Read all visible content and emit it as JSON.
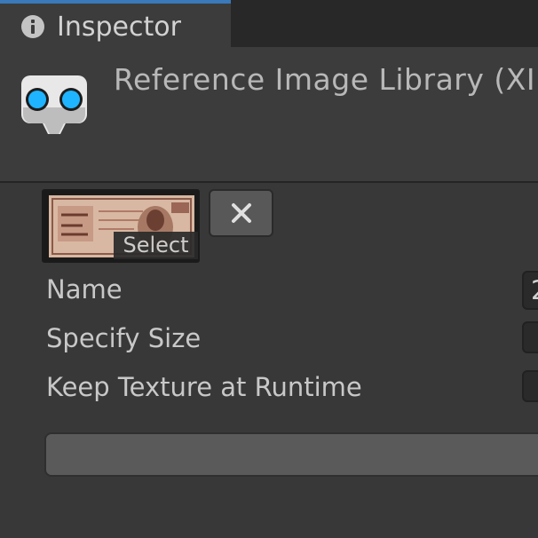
{
  "tab": {
    "title": "Inspector",
    "icon": "info-icon"
  },
  "header": {
    "title": "Reference Image Library (XI",
    "icon": "xr-goggles-icon"
  },
  "image_entry": {
    "thumbnail_icon": "banknote-texture-thumbnail",
    "select_label": "Select",
    "remove_icon": "close-icon"
  },
  "fields": {
    "name_label": "Name",
    "name_value": "2",
    "specify_size_label": "Specify Size",
    "keep_texture_label": "Keep Texture at Runtime"
  },
  "colors": {
    "accent": "#3a79bb",
    "panel": "#383838",
    "goggle_lens": "#1fb4ff"
  }
}
